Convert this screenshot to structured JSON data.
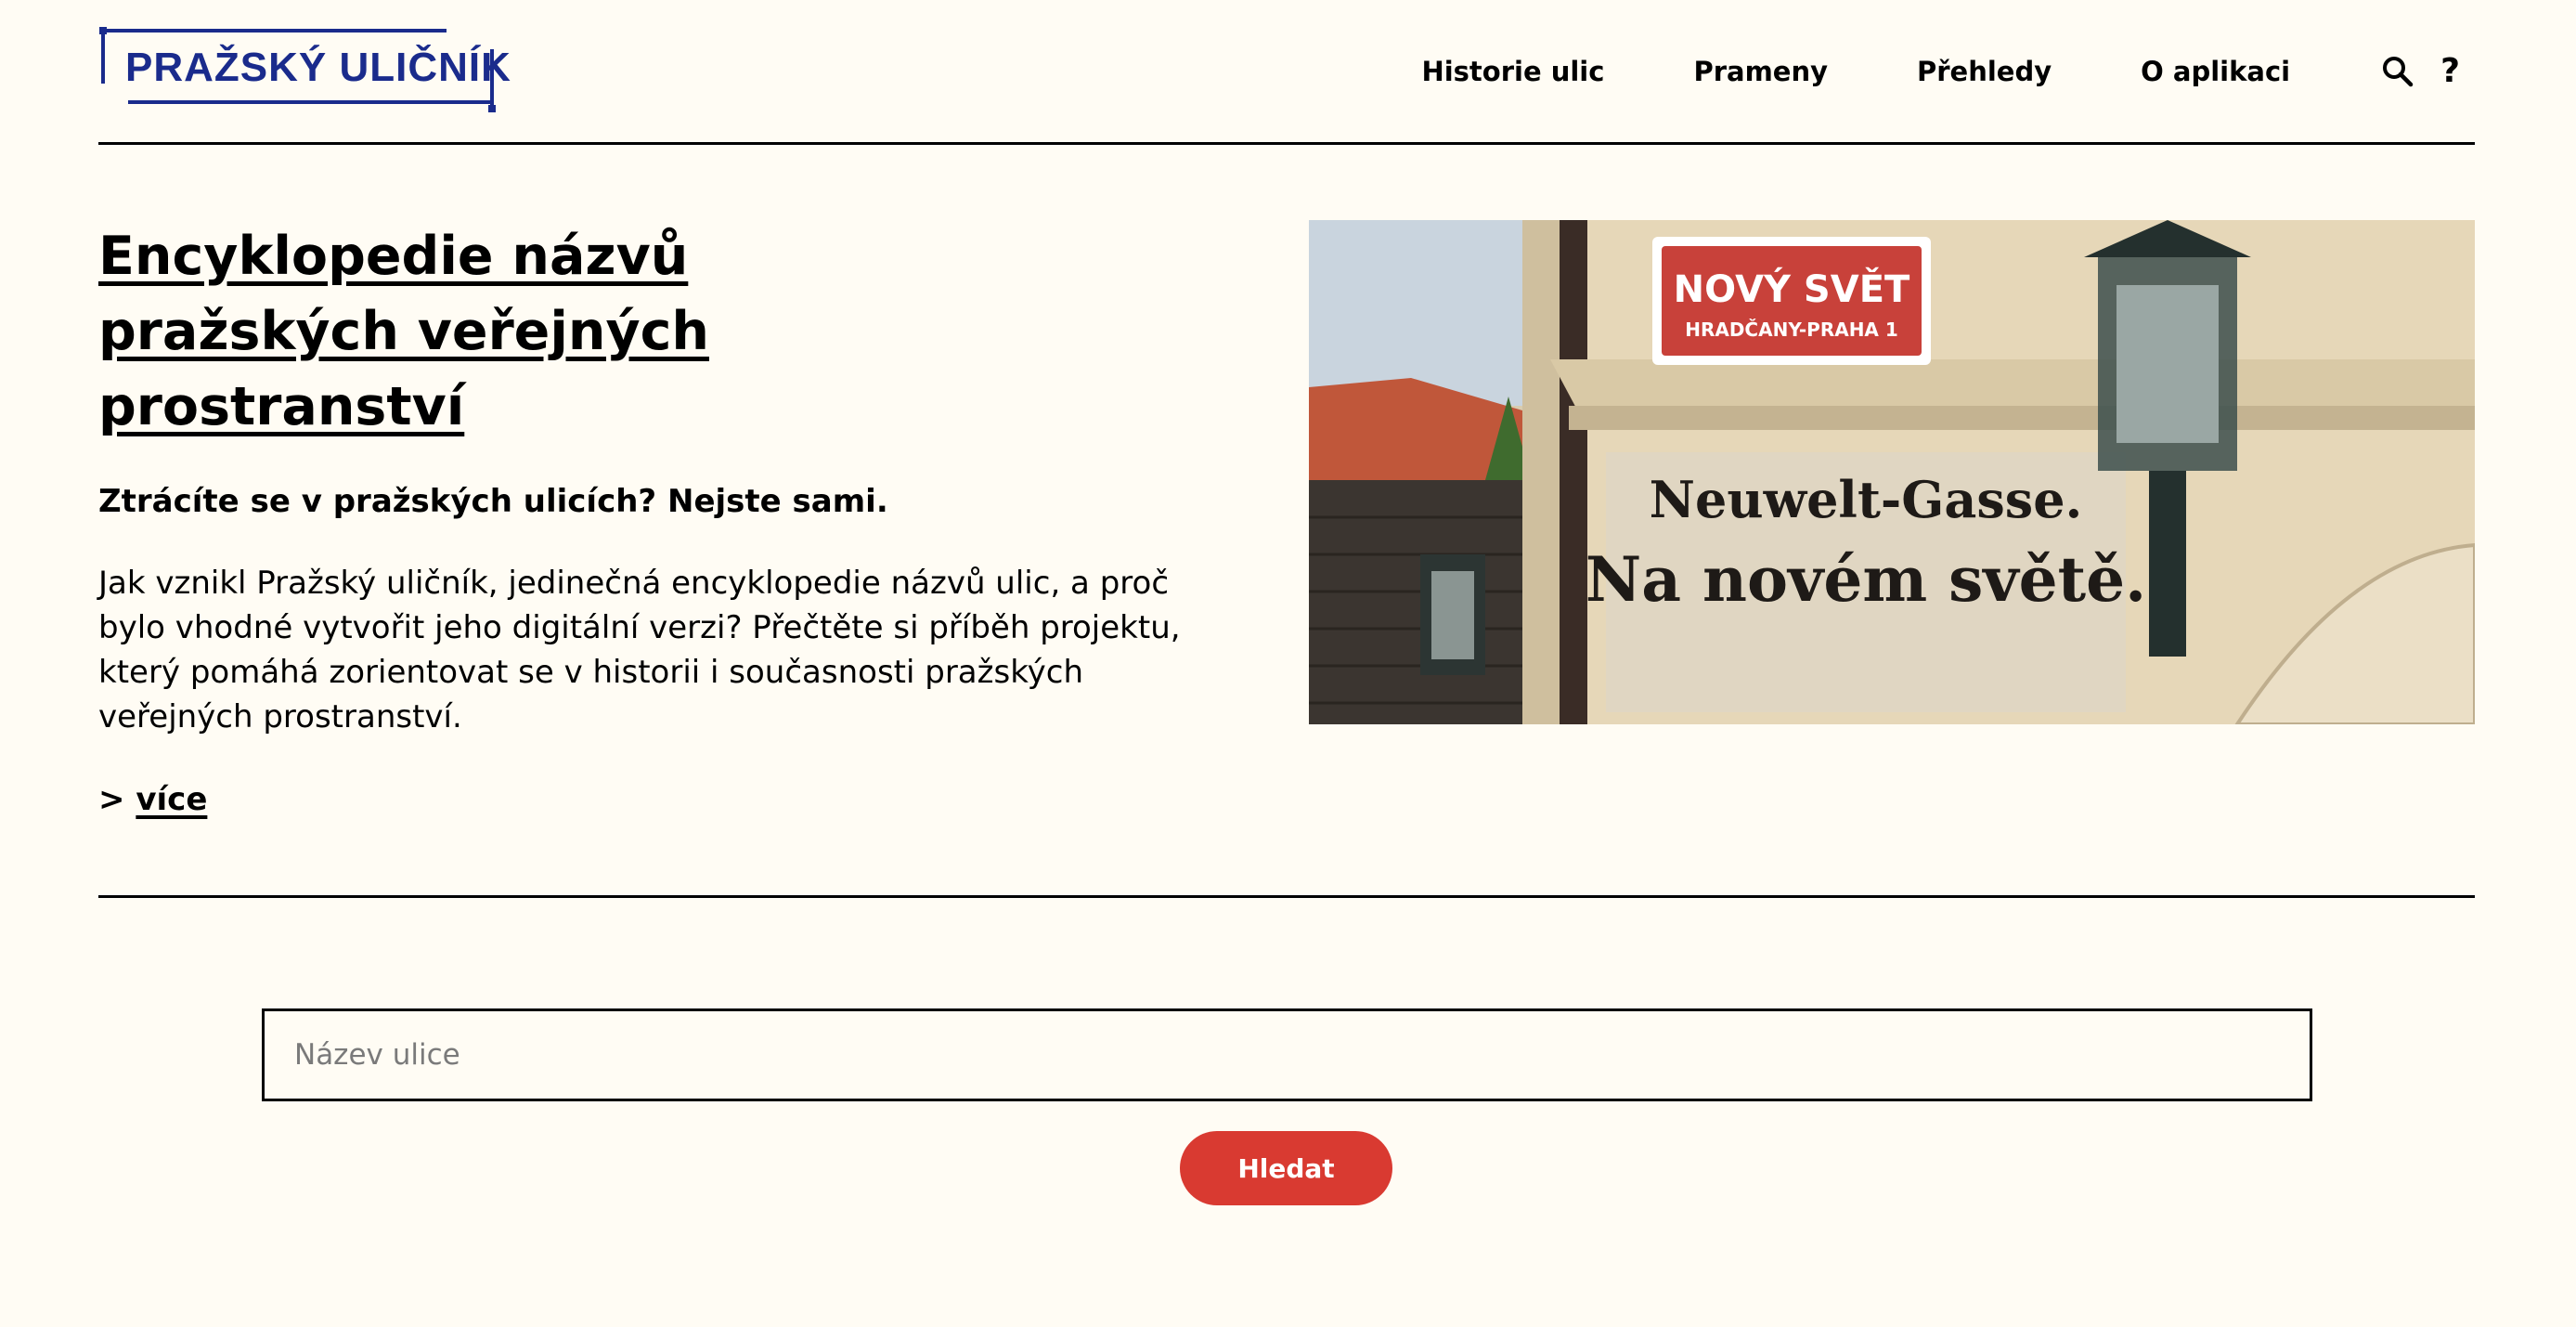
{
  "header": {
    "logo_text": "PRAŽSKÝ ULIČNÍK",
    "nav": [
      {
        "label": "Historie ulic"
      },
      {
        "label": "Prameny"
      },
      {
        "label": "Přehledy"
      },
      {
        "label": "O aplikaci"
      }
    ],
    "search_icon": "search-icon",
    "help_label": "?"
  },
  "hero": {
    "title": "Encyklopedie názvů pražských veřejných prostranství",
    "lead": "Ztrácíte se v pražských ulicích? Nejste sami.",
    "body": "Jak vznikl Pražský uličník, jedinečná encyklopedie názvů ulic, a proč bylo vhodné vytvořit jeho digitální verzi? Přečtěte si příběh projektu, který pomáhá zorientovat se v historii i současnosti pražských veřejných prostranství.",
    "more_prefix": ">",
    "more_label": "více"
  },
  "photo": {
    "sign_top_line1": "NOVÝ SVĚT",
    "sign_top_line2": "HRADČANY-PRAHA 1",
    "sign_old_line1": "Neuwelt-Gasse.",
    "sign_old_line2": "Na novém světě."
  },
  "search": {
    "placeholder": "Název ulice",
    "button_label": "Hledat"
  },
  "colors": {
    "background": "#fffcf4",
    "brand_blue": "#1a2b8c",
    "accent_red": "#d93a31"
  }
}
